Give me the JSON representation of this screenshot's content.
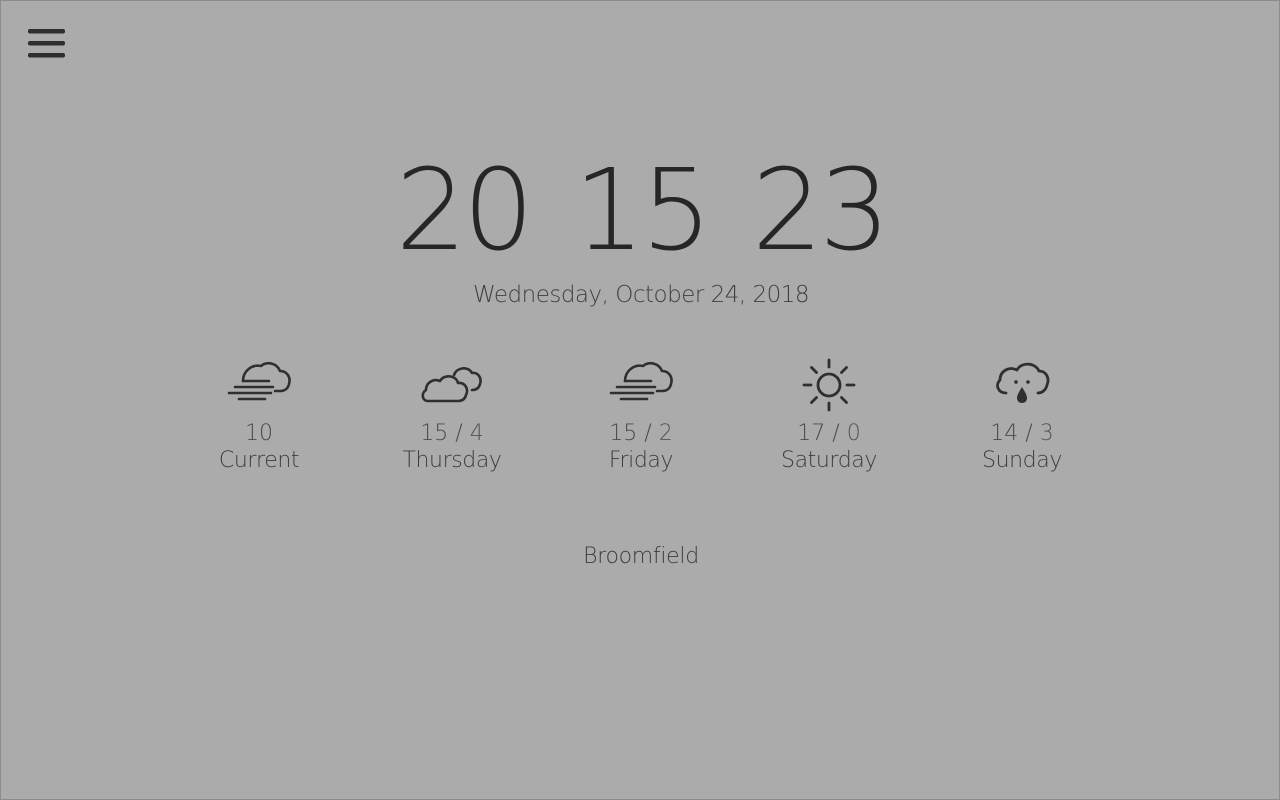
{
  "clock": {
    "hours": "20",
    "minutes": "15",
    "seconds": "23"
  },
  "date": "Wednesday, October 24, 2018",
  "forecast": [
    {
      "label": "Current",
      "temp": "10",
      "hi": "",
      "lo": "",
      "icon": "wind-cloud-icon"
    },
    {
      "label": "Thursday",
      "temp": "",
      "hi": "15",
      "lo": "4",
      "icon": "partly-cloudy-icon"
    },
    {
      "label": "Friday",
      "temp": "",
      "hi": "15",
      "lo": "2",
      "icon": "wind-cloud-icon"
    },
    {
      "label": "Saturday",
      "temp": "",
      "hi": "17",
      "lo": "0",
      "icon": "sun-icon"
    },
    {
      "label": "Sunday",
      "temp": "",
      "hi": "14",
      "lo": "3",
      "icon": "rain-cloud-icon"
    }
  ],
  "separator": "/",
  "location": "Broomfield",
  "colors": {
    "background": "#ababab",
    "text": "#2a2a2a",
    "icon": "#333333"
  }
}
